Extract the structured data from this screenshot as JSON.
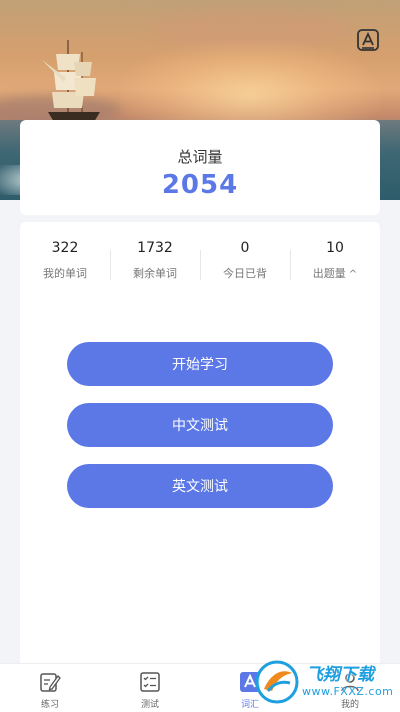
{
  "total": {
    "label": "总词量",
    "value": "2054"
  },
  "stats": [
    {
      "value": "322",
      "label": "我的单词"
    },
    {
      "value": "1732",
      "label": "剩余单词"
    },
    {
      "value": "0",
      "label": "今日已背"
    },
    {
      "value": "10",
      "label": "出题量",
      "caret": "^"
    }
  ],
  "actions": {
    "start_label": "开始学习",
    "chinese_test_label": "中文测试",
    "english_test_label": "英文测试"
  },
  "nav": [
    {
      "label": "练习",
      "icon": "pencil-note-icon"
    },
    {
      "label": "测试",
      "icon": "checklist-icon"
    },
    {
      "label": "词汇",
      "icon": "vocabulary-a-icon"
    },
    {
      "label": "我的",
      "icon": "user-icon"
    }
  ],
  "watermark": {
    "main": "飞翔下载",
    "sub": "www.FXXZ.com"
  },
  "colors": {
    "accent": "#5b78e6",
    "background": "#f2f4f8"
  }
}
